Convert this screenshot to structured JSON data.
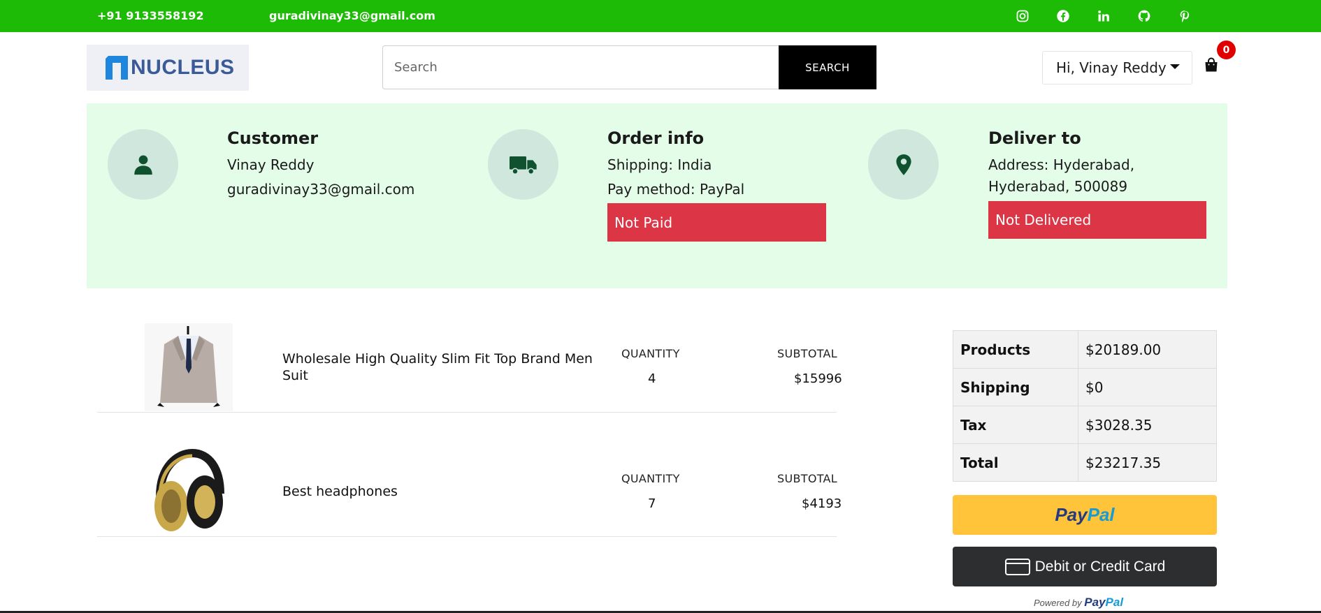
{
  "topbar": {
    "phone": "+91 9133558192",
    "email": "guradivinay33@gmail.com",
    "social_icons": [
      "instagram-icon",
      "facebook-icon",
      "linkedin-icon",
      "github-icon",
      "pinterest-icon"
    ]
  },
  "header": {
    "logo_text": "NUCLEUS",
    "search_placeholder": "Search",
    "search_value": "",
    "search_button": "SEARCH",
    "user_greeting": "Hi, Vinay Reddy",
    "cart_count": "0"
  },
  "info": {
    "customer": {
      "title": "Customer",
      "name": "Vinay Reddy",
      "email": "guradivinay33@gmail.com"
    },
    "order": {
      "title": "Order info",
      "shipping": "Shipping: India",
      "pay_method": "Pay method: PayPal",
      "status": "Not Paid"
    },
    "delivery": {
      "title": "Deliver to",
      "address_line1": "Address: Hyderabad,",
      "address_line2": "Hyderabad, 500089",
      "status": "Not Delivered"
    }
  },
  "items": [
    {
      "name": "Wholesale High Quality Slim Fit Top Brand Men Suit",
      "quantity_label": "QUANTITY",
      "quantity": "4",
      "subtotal_label": "SUBTOTAL",
      "subtotal": "$15996"
    },
    {
      "name": "Best headphones",
      "quantity_label": "QUANTITY",
      "quantity": "7",
      "subtotal_label": "SUBTOTAL",
      "subtotal": "$4193"
    }
  ],
  "summary": [
    {
      "label": "Products",
      "value": "$20189.00"
    },
    {
      "label": "Shipping",
      "value": "$0"
    },
    {
      "label": "Tax",
      "value": "$3028.35"
    },
    {
      "label": "Total",
      "value": "$23217.35"
    }
  ],
  "payment": {
    "paypal_pay": "Pay",
    "paypal_pal": "Pal",
    "card_button": "Debit or Credit Card",
    "powered_by": "Powered by",
    "powered_pay": "Pay",
    "powered_pal": "Pal"
  },
  "colors": {
    "topbar": "#1dbb05",
    "panel_bg": "#e4fde9",
    "danger": "#dc3545",
    "icon_green": "#10522f",
    "paypal_yellow": "#ffc439",
    "paypal_dark_blue": "#253b80",
    "paypal_light_blue": "#179bd7"
  }
}
